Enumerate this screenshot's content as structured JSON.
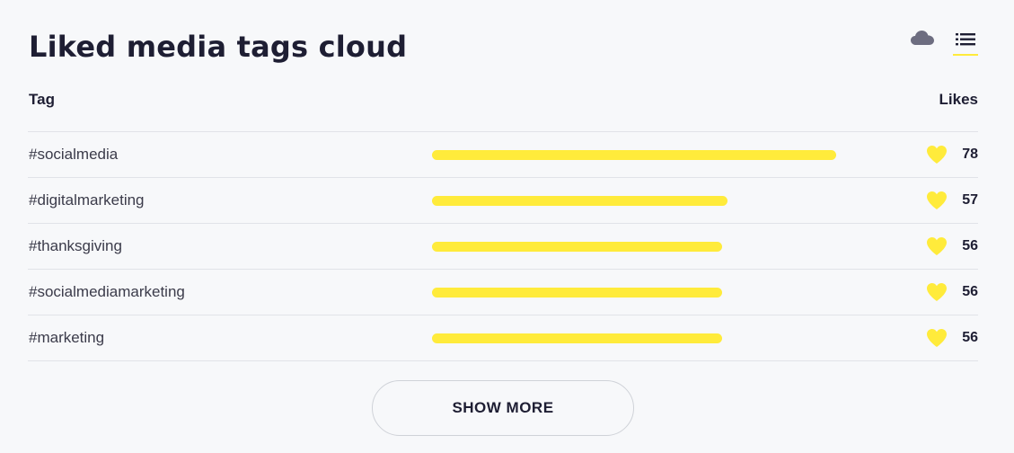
{
  "widget": {
    "title": "Liked media tags cloud",
    "view_toggle": {
      "cloud_icon": "cloud-icon",
      "list_icon": "list-icon",
      "active": "list"
    },
    "columns": {
      "tag": "Tag",
      "likes": "Likes"
    },
    "rows": [
      {
        "tag": "#socialmedia",
        "likes": "78",
        "value": 78
      },
      {
        "tag": "#digitalmarketing",
        "likes": "57",
        "value": 57
      },
      {
        "tag": "#thanksgiving",
        "likes": "56",
        "value": 56
      },
      {
        "tag": "#socialmediamarketing",
        "likes": "56",
        "value": 56
      },
      {
        "tag": "#marketing",
        "likes": "56",
        "value": 56
      }
    ],
    "max_value": 78,
    "show_more_label": "SHOW MORE"
  },
  "colors": {
    "accent": "#ffeb3b",
    "icon_gray": "#6d6d80",
    "text": "#1e1e33",
    "background": "#f7f8fa"
  }
}
